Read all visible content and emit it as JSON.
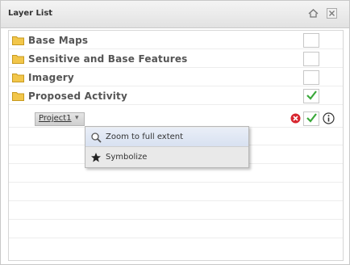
{
  "header": {
    "title": "Layer List",
    "home_icon": "home-icon",
    "close_icon": "close-icon"
  },
  "layers": [
    {
      "label": "Base Maps",
      "icon": "folder-icon",
      "checked": false
    },
    {
      "label": "Sensitive and Base Features",
      "icon": "folder-icon",
      "checked": false
    },
    {
      "label": "Imagery",
      "icon": "folder-icon",
      "checked": false
    },
    {
      "label": "Proposed Activity",
      "icon": "folder-icon",
      "checked": true
    }
  ],
  "sublayer": {
    "label": "Project1",
    "checked": true,
    "remove_icon": "remove-icon",
    "info_icon": "info-icon"
  },
  "context_menu": {
    "items": [
      {
        "label": "Zoom to full extent",
        "icon": "zoom-icon"
      },
      {
        "label": "Symbolize",
        "icon": "star-icon"
      }
    ]
  },
  "colors": {
    "check": "#3aa83a",
    "remove": "#d8262f",
    "folder": "#f2c64a",
    "accent": "#1f4fbf"
  }
}
